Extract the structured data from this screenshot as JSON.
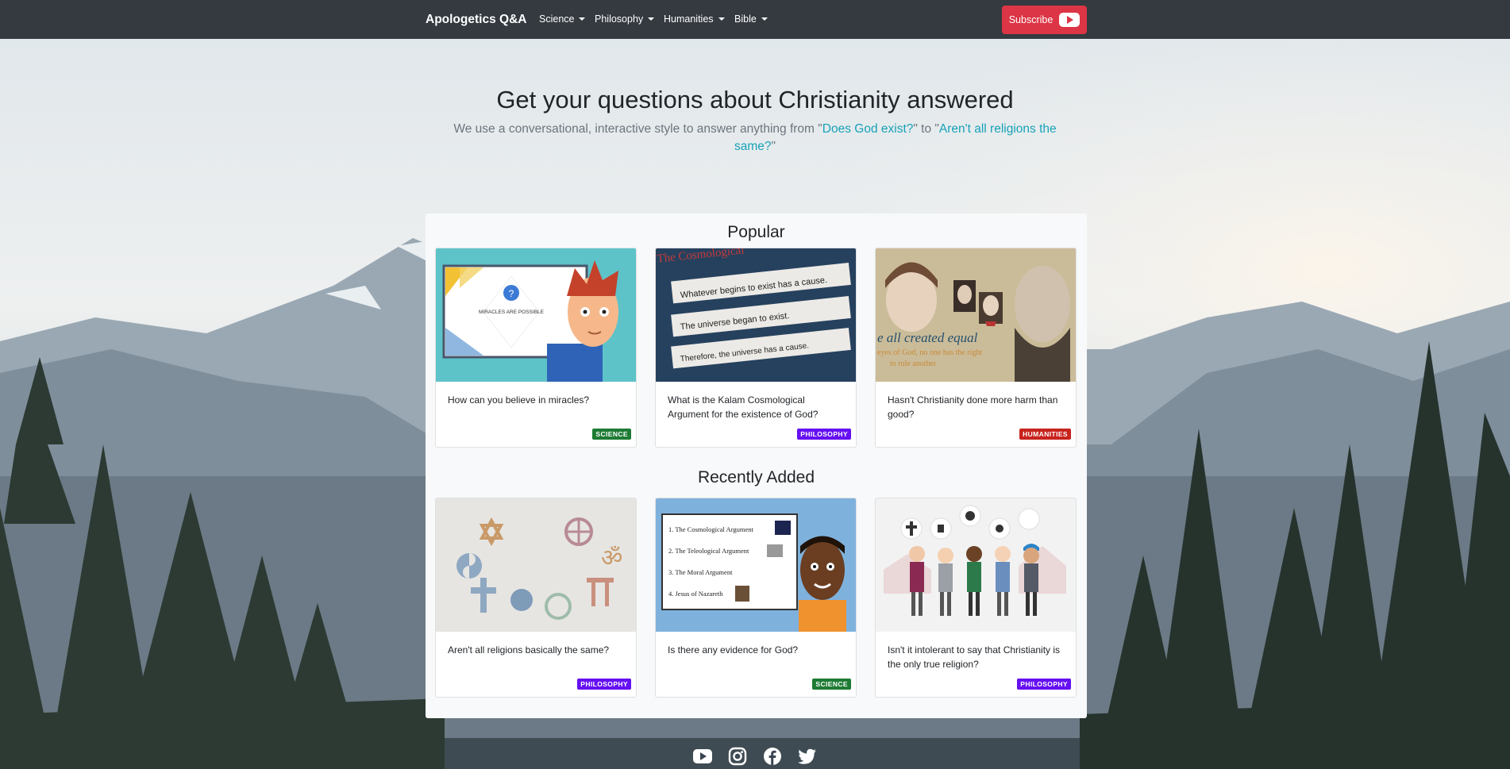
{
  "nav": {
    "brand": "Apologetics Q&A",
    "menus": [
      {
        "label": "Science"
      },
      {
        "label": "Philosophy"
      },
      {
        "label": "Humanities"
      },
      {
        "label": "Bible"
      }
    ],
    "subscribe_label": "Subscribe"
  },
  "hero": {
    "title": "Get your questions about Christianity answered",
    "subtitle_prefix": "We use a conversational, interactive style to answer anything from \"",
    "link1": "Does God exist?",
    "subtitle_mid": "\" to \"",
    "link2": "Aren't all religions the same?",
    "subtitle_suffix": "\""
  },
  "popular": {
    "title": "Popular",
    "cards": [
      {
        "question": "How can you believe in miracles?",
        "category": "SCIENCE",
        "thumb_text": "MIRACLES ARE POSSIBLE",
        "thumb_icon": "cartoon-presenter"
      },
      {
        "question": "What is the Kalam Cosmological Argument for the existence of God?",
        "category": "PHILOSOPHY",
        "thumb_lines": [
          "The Cosmological",
          "Whatever begins to exist has a cause.",
          "The universe began to exist.",
          "Therefore, the universe has a cause."
        ]
      },
      {
        "question": "Hasn't Christianity done more harm than good?",
        "category": "HUMANITIES",
        "thumb_lines": [
          "e all created equal",
          "eyes of God, no one has the right",
          "to rule another"
        ]
      }
    ]
  },
  "recent": {
    "title": "Recently Added",
    "cards": [
      {
        "question": "Aren't all religions basically the same?",
        "category": "PHILOSOPHY",
        "thumb_icon": "religious-symbols"
      },
      {
        "question": "Is there any evidence for God?",
        "category": "SCIENCE",
        "thumb_lines": [
          "1. The Cosmological Argument",
          "2. The Teleological Argument",
          "3. The Moral Argument",
          "4. Jesus of Nazareth"
        ]
      },
      {
        "question": "Isn't it intolerant to say that Christianity is the only true religion?",
        "category": "PHILOSOPHY",
        "thumb_icon": "people-of-faiths"
      }
    ]
  },
  "colors": {
    "navbar": "#343a40",
    "subscribe": "#dc3545",
    "link": "#17a2b8",
    "science": "#1e7b34",
    "philosophy": "#6610f2",
    "humanities": "#c8231d"
  },
  "social": [
    "youtube-icon",
    "instagram-icon",
    "facebook-icon",
    "twitter-icon"
  ]
}
